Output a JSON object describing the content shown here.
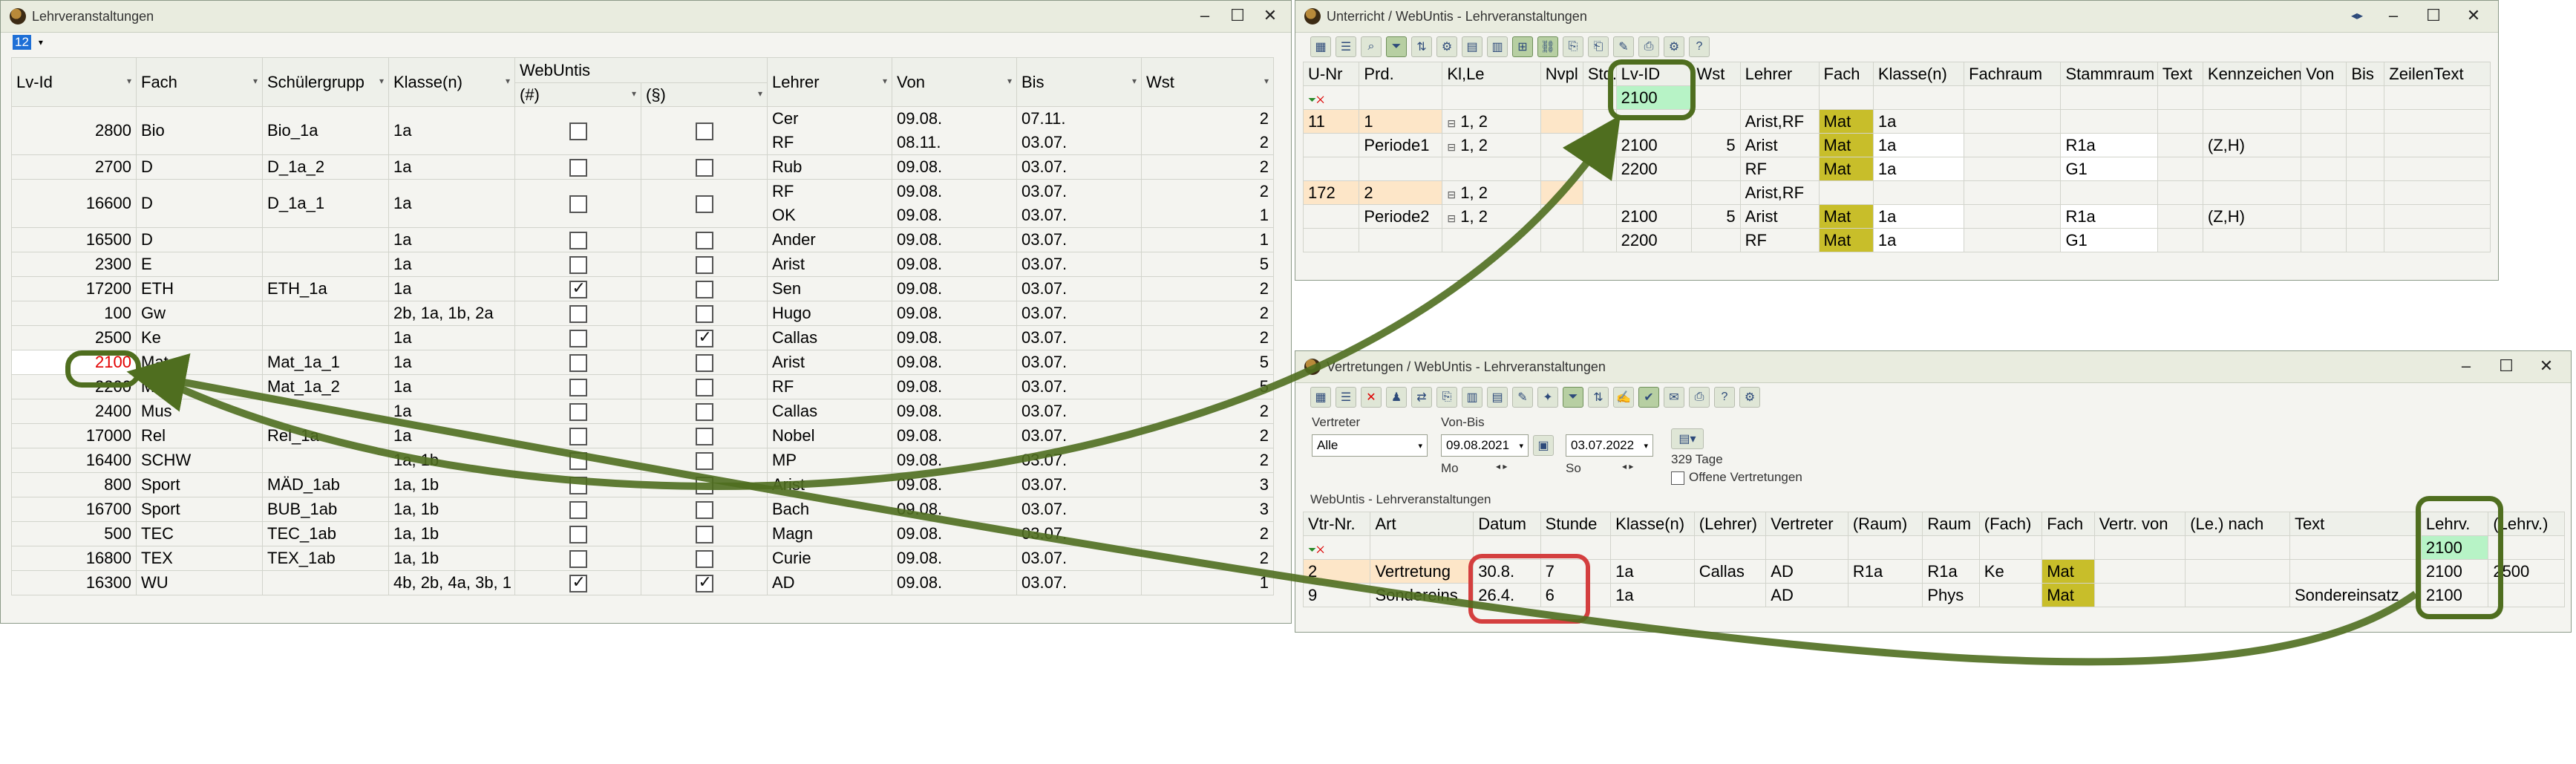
{
  "left": {
    "title": "Lehrveranstaltungen",
    "combo": "12",
    "headers": [
      "Lv-Id",
      "Fach",
      "Schülergrupp",
      "Klasse(n)",
      "(#)",
      "(§)",
      "Lehrer",
      "Von",
      "Bis",
      "Wst"
    ],
    "webuntis_group": "WebUntis",
    "rows": [
      {
        "id": "2800",
        "fach": "Bio",
        "sg": "Bio_1a",
        "kl": "1a",
        "c1": false,
        "c2": false,
        "l": [
          "Cer",
          "RF"
        ],
        "von": [
          "09.08.",
          "08.11."
        ],
        "bis": [
          "07.11.",
          "03.07."
        ],
        "w": [
          "2",
          "2"
        ]
      },
      {
        "id": "2700",
        "fach": "D",
        "sg": "D_1a_2",
        "kl": "1a",
        "c1": false,
        "c2": false,
        "l": [
          "Rub"
        ],
        "von": [
          "09.08."
        ],
        "bis": [
          "03.07."
        ],
        "w": [
          "2"
        ]
      },
      {
        "id": "16600",
        "fach": "D",
        "sg": "D_1a_1",
        "kl": "1a",
        "c1": false,
        "c2": false,
        "l": [
          "RF",
          "OK"
        ],
        "von": [
          "09.08.",
          "09.08."
        ],
        "bis": [
          "03.07.",
          "03.07."
        ],
        "w": [
          "2",
          "1"
        ]
      },
      {
        "id": "16500",
        "fach": "D",
        "sg": "",
        "kl": "1a",
        "c1": false,
        "c2": false,
        "l": [
          "Ander"
        ],
        "von": [
          "09.08."
        ],
        "bis": [
          "03.07."
        ],
        "w": [
          "1"
        ]
      },
      {
        "id": "2300",
        "fach": "E",
        "sg": "",
        "kl": "1a",
        "c1": false,
        "c2": false,
        "l": [
          "Arist"
        ],
        "von": [
          "09.08."
        ],
        "bis": [
          "03.07."
        ],
        "w": [
          "5"
        ]
      },
      {
        "id": "17200",
        "fach": "ETH",
        "sg": "ETH_1a",
        "kl": "1a",
        "c1": true,
        "c2": false,
        "l": [
          "Sen"
        ],
        "von": [
          "09.08."
        ],
        "bis": [
          "03.07."
        ],
        "w": [
          "2"
        ]
      },
      {
        "id": "100",
        "fach": "Gw",
        "sg": "",
        "kl": "2b, 1a, 1b, 2a",
        "c1": false,
        "c2": false,
        "l": [
          "Hugo"
        ],
        "von": [
          "09.08."
        ],
        "bis": [
          "03.07."
        ],
        "w": [
          "2"
        ]
      },
      {
        "id": "2500",
        "fach": "Ke",
        "sg": "",
        "kl": "1a",
        "c1": false,
        "c2": true,
        "l": [
          "Callas"
        ],
        "von": [
          "09.08."
        ],
        "bis": [
          "03.07."
        ],
        "w": [
          "2"
        ]
      },
      {
        "id": "2100",
        "fach": "Mat",
        "sg": "Mat_1a_1",
        "kl": "1a",
        "c1": false,
        "c2": false,
        "l": [
          "Arist"
        ],
        "von": [
          "09.08."
        ],
        "bis": [
          "03.07."
        ],
        "w": [
          "5"
        ]
      },
      {
        "id": "2200",
        "fach": "Mat",
        "sg": "Mat_1a_2",
        "kl": "1a",
        "c1": false,
        "c2": false,
        "l": [
          "RF"
        ],
        "von": [
          "09.08."
        ],
        "bis": [
          "03.07."
        ],
        "w": [
          "5"
        ]
      },
      {
        "id": "2400",
        "fach": "Mus",
        "sg": "",
        "kl": "1a",
        "c1": false,
        "c2": false,
        "l": [
          "Callas"
        ],
        "von": [
          "09.08."
        ],
        "bis": [
          "03.07."
        ],
        "w": [
          "2"
        ]
      },
      {
        "id": "17000",
        "fach": "Rel",
        "sg": "Rel_1a",
        "kl": "1a",
        "c1": false,
        "c2": false,
        "l": [
          "Nobel"
        ],
        "von": [
          "09.08."
        ],
        "bis": [
          "03.07."
        ],
        "w": [
          "2"
        ]
      },
      {
        "id": "16400",
        "fach": "SCHW",
        "sg": "",
        "kl": "1a, 1b",
        "c1": false,
        "c2": false,
        "l": [
          "MP"
        ],
        "von": [
          "09.08."
        ],
        "bis": [
          "03.07."
        ],
        "w": [
          "2"
        ]
      },
      {
        "id": "800",
        "fach": "Sport",
        "sg": "MÄD_1ab",
        "kl": "1a, 1b",
        "c1": false,
        "c2": false,
        "l": [
          "Arist"
        ],
        "von": [
          "09.08."
        ],
        "bis": [
          "03.07."
        ],
        "w": [
          "3"
        ]
      },
      {
        "id": "16700",
        "fach": "Sport",
        "sg": "BUB_1ab",
        "kl": "1a, 1b",
        "c1": false,
        "c2": false,
        "l": [
          "Bach"
        ],
        "von": [
          "09.08."
        ],
        "bis": [
          "03.07."
        ],
        "w": [
          "3"
        ]
      },
      {
        "id": "500",
        "fach": "TEC",
        "sg": "TEC_1ab",
        "kl": "1a, 1b",
        "c1": false,
        "c2": false,
        "l": [
          "Magn"
        ],
        "von": [
          "09.08."
        ],
        "bis": [
          "03.07."
        ],
        "w": [
          "2"
        ]
      },
      {
        "id": "16800",
        "fach": "TEX",
        "sg": "TEX_1ab",
        "kl": "1a, 1b",
        "c1": false,
        "c2": false,
        "l": [
          "Curie"
        ],
        "von": [
          "09.08."
        ],
        "bis": [
          "03.07."
        ],
        "w": [
          "2"
        ]
      },
      {
        "id": "16300",
        "fach": "WU",
        "sg": "",
        "kl": "4b, 2b, 4a, 3b, 1",
        "c1": true,
        "c2": true,
        "l": [
          "AD"
        ],
        "von": [
          "09.08."
        ],
        "bis": [
          "03.07."
        ],
        "w": [
          "1"
        ]
      }
    ]
  },
  "unterricht": {
    "title": "Unterricht / WebUntis - Lehrveranstaltungen",
    "headers": [
      "U-Nr",
      "Prd.",
      "Kl,Le",
      "Nvpl",
      "Std.",
      "Lv-ID",
      "Wst",
      "Lehrer",
      "Fach",
      "Klasse(n)",
      "Fachraum",
      "Stammraum",
      "Text",
      "Kennzeichen",
      "Von",
      "Bis",
      "ZeilenText"
    ],
    "filter_value": "2100",
    "rows": [
      {
        "unr": "11",
        "prd": "1",
        "klle": "1, 2",
        "lvid": "",
        "wst": "",
        "lehrer": "Arist,RF",
        "fach": "Mat",
        "kl": "1a",
        "stamm": "",
        "kenn": ""
      },
      {
        "unr": "",
        "prd": "Periode1",
        "klle": "1, 2",
        "lvid": "2100",
        "wst": "5",
        "lehrer": "Arist",
        "fach": "Mat",
        "kl": "1a",
        "stamm": "R1a",
        "kenn": "(Z,H)"
      },
      {
        "unr": "",
        "prd": "",
        "klle": "",
        "lvid": "2200",
        "wst": "",
        "lehrer": "RF",
        "fach": "Mat",
        "kl": "1a",
        "stamm": "G1",
        "kenn": ""
      },
      {
        "unr": "172",
        "prd": "2",
        "klle": "1, 2",
        "lvid": "",
        "wst": "",
        "lehrer": "Arist,RF",
        "fach": "",
        "kl": "",
        "stamm": "",
        "kenn": ""
      },
      {
        "unr": "",
        "prd": "Periode2",
        "klle": "1, 2",
        "lvid": "2100",
        "wst": "5",
        "lehrer": "Arist",
        "fach": "Mat",
        "kl": "1a",
        "stamm": "R1a",
        "kenn": "(Z,H)"
      },
      {
        "unr": "",
        "prd": "",
        "klle": "",
        "lvid": "2200",
        "wst": "",
        "lehrer": "RF",
        "fach": "Mat",
        "kl": "1a",
        "stamm": "G1",
        "kenn": ""
      }
    ]
  },
  "vertretungen": {
    "title": "Vertretungen / WebUntis - Lehrveranstaltungen",
    "vertreter_label": "Vertreter",
    "vertreter_value": "Alle",
    "vonbis_label": "Von-Bis",
    "von": "09.08.2021",
    "bis": "03.07.2022",
    "von_day": "Mo",
    "bis_day": "So",
    "tage": "329 Tage",
    "offene_label": "Offene Vertretungen",
    "section_label": "WebUntis - Lehrveranstaltungen",
    "headers": [
      "Vtr-Nr.",
      "Art",
      "Datum",
      "Stunde",
      "Klasse(n)",
      "(Lehrer)",
      "Vertreter",
      "(Raum)",
      "Raum",
      "(Fach)",
      "Fach",
      "Vertr. von",
      "(Le.) nach",
      "Text",
      "Lehrv.",
      "(Lehrv.)"
    ],
    "filter_value": "2100",
    "rows": [
      {
        "nr": "2",
        "art": "Vertretung",
        "datum": "30.8.",
        "stunde": "7",
        "kl": "1a",
        "lehrer": "Callas",
        "vertreter": "AD",
        "raum1": "R1a",
        "raum": "R1a",
        "fach1": "Ke",
        "fach": "Mat",
        "text": "",
        "lv": "2100",
        "lv2": "2500"
      },
      {
        "nr": "9",
        "art": "Sondereins",
        "datum": "26.4.",
        "stunde": "6",
        "kl": "1a",
        "lehrer": "",
        "vertreter": "AD",
        "raum1": "",
        "raum": "Phys",
        "fach1": "",
        "fach": "Mat",
        "text": "Sondereinsatz",
        "lv": "2100",
        "lv2": ""
      }
    ]
  },
  "colors": {
    "accent_green": "#4f6e1f",
    "callout_red": "#d43f3f",
    "olive": "#c8be2a",
    "id_red": "#e20000"
  }
}
